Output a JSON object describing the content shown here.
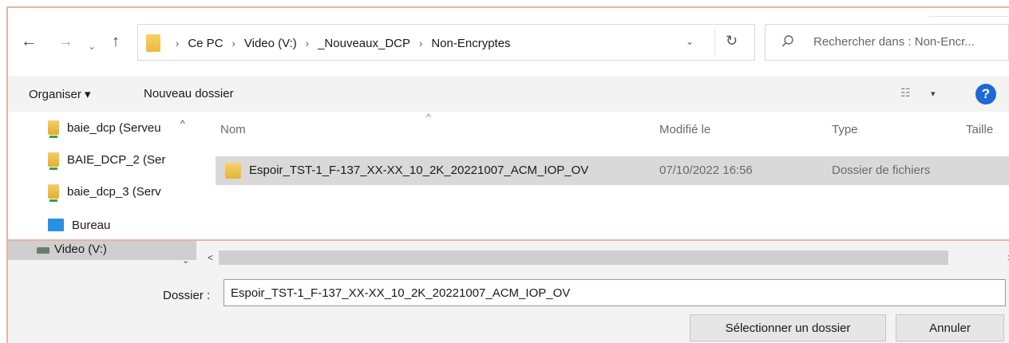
{
  "address": {
    "crumbs": [
      "Ce PC",
      "Video (V:)",
      "_Nouveaux_DCP",
      "Non-Encryptes"
    ],
    "separator": "›",
    "dropdown_glyph": "⌄",
    "refresh_glyph": "↻"
  },
  "nav": {
    "back_glyph": "←",
    "forward_glyph": "→",
    "recent_glyph": "⌄",
    "up_glyph": "↑"
  },
  "search": {
    "placeholder": "Rechercher dans : Non-Encr..."
  },
  "toolbar": {
    "organize_label": "Organiser ▾",
    "new_folder_label": "Nouveau dossier",
    "view_glyph": "☷",
    "view_dropdown_glyph": "▾",
    "help_glyph": "?"
  },
  "nav_pane": {
    "items": [
      {
        "label": "baie_dcp (Serveu",
        "icon": "network-folder-icon"
      },
      {
        "label": "BAIE_DCP_2 (Ser",
        "icon": "network-folder-icon"
      },
      {
        "label": "baie_dcp_3 (Serv",
        "icon": "network-folder-icon"
      },
      {
        "label": "Bureau",
        "icon": "desktop-icon"
      }
    ],
    "selected_item": {
      "label": "Video (V:)",
      "icon": "network-drive-icon"
    },
    "scroll_up_glyph": "^",
    "collapse_glyph": "⌄"
  },
  "file_list": {
    "columns": [
      "Nom",
      "Modifié le",
      "Type",
      "Taille"
    ],
    "sort_glyph": "^",
    "rows": [
      {
        "name": "Espoir_TST-1_F-137_XX-XX_10_2K_20221007_ACM_IOP_OV",
        "modified": "07/10/2022 16:56",
        "type": "Dossier de fichiers",
        "icon": "folder-icon"
      }
    ]
  },
  "hscroll": {
    "left_glyph": "<",
    "right_glyph": ">"
  },
  "footer": {
    "folder_label": "Dossier :",
    "folder_value": "Espoir_TST-1_F-137_XX-XX_10_2K_20221007_ACM_IOP_OV",
    "select_button": "Sélectionner un dossier",
    "cancel_button": "Annuler"
  },
  "colors": {
    "accent_border": "#e8b4a8",
    "help_blue": "#1d6ad6",
    "folder_yellow": "#f7d26a",
    "selection_gray": "#d9d9d9"
  }
}
